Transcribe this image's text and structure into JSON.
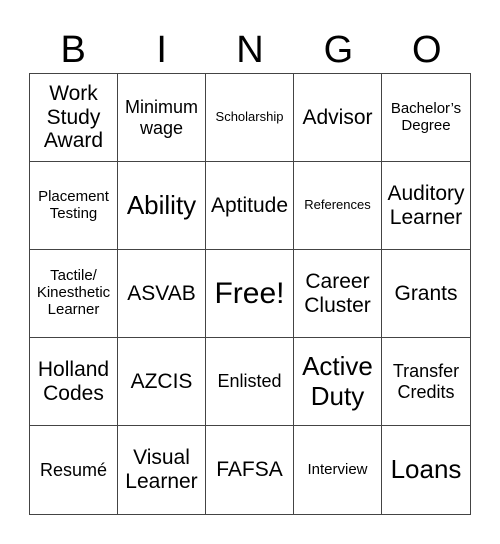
{
  "header": {
    "letters": [
      "B",
      "I",
      "N",
      "G",
      "O"
    ]
  },
  "grid": {
    "rows": [
      [
        "Work Study Award",
        "Minimum wage",
        "Scholarship",
        "Advisor",
        "Bachelor’s Degree"
      ],
      [
        "Placement Testing",
        "Ability",
        "Aptitude",
        "References",
        "Auditory Learner"
      ],
      [
        "Tactile/ Kinesthetic Learner",
        "ASVAB",
        "Free!",
        "Career Cluster",
        "Grants"
      ],
      [
        "Holland Codes",
        "AZCIS",
        "Enlisted",
        "Active Duty",
        "Transfer Credits"
      ],
      [
        "Resumé",
        "Visual Learner",
        "FAFSA",
        "Interview",
        "Loans"
      ]
    ]
  }
}
